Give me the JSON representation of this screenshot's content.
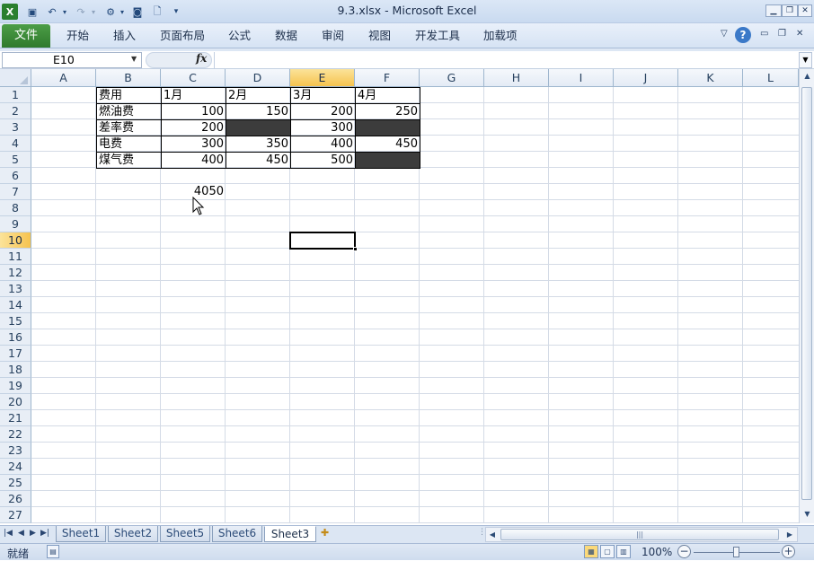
{
  "window": {
    "title": "9.3.xlsx  -  Microsoft Excel",
    "icons": [
      "excel-logo-icon",
      "save-icon",
      "undo-icon",
      "redo-icon",
      "macro-icon",
      "camera-icon",
      "print-preview-icon",
      "customize-qat-icon"
    ]
  },
  "ribbon": {
    "file_label": "文件",
    "tabs": [
      "开始",
      "插入",
      "页面布局",
      "公式",
      "数据",
      "审阅",
      "视图",
      "开发工具",
      "加载项"
    ],
    "help": "?"
  },
  "formula_bar": {
    "name_box": "E10",
    "fx": "fx",
    "content": ""
  },
  "columns": [
    "A",
    "B",
    "C",
    "D",
    "E",
    "F",
    "G",
    "H",
    "I",
    "J",
    "K",
    "L"
  ],
  "selected_column": "E",
  "selected_row": 10,
  "rows": [
    1,
    2,
    3,
    4,
    5,
    6,
    7,
    8,
    9,
    10,
    11,
    12,
    13,
    14,
    15,
    16,
    17,
    18,
    19,
    20,
    21,
    22,
    23,
    24,
    25,
    26,
    27
  ],
  "table": {
    "header": [
      "费用",
      "1月",
      "2月",
      "3月",
      "4月"
    ],
    "rows": [
      {
        "label": "燃油费",
        "values": [
          "100",
          "150",
          "200",
          "250"
        ],
        "dark": [
          false,
          false,
          false,
          false
        ]
      },
      {
        "label": "差率费",
        "values": [
          "200",
          "",
          "300",
          ""
        ],
        "dark": [
          false,
          true,
          false,
          true
        ]
      },
      {
        "label": "电费",
        "values": [
          "300",
          "350",
          "400",
          "450"
        ],
        "dark": [
          false,
          false,
          false,
          false
        ]
      },
      {
        "label": "煤气费",
        "values": [
          "400",
          "450",
          "500",
          ""
        ],
        "dark": [
          false,
          false,
          false,
          true
        ]
      }
    ]
  },
  "extra_cell": {
    "ref": "C7",
    "value": "4050"
  },
  "sheets": [
    "Sheet1",
    "Sheet2",
    "Sheet5",
    "Sheet6",
    "Sheet3"
  ],
  "active_sheet": "Sheet3",
  "status": {
    "ready": "就绪",
    "zoom": "100%"
  },
  "colors": {
    "accent": "#2f7a2d",
    "selected_header": "#f6c34f",
    "dark_fill": "#3c3c3c"
  }
}
